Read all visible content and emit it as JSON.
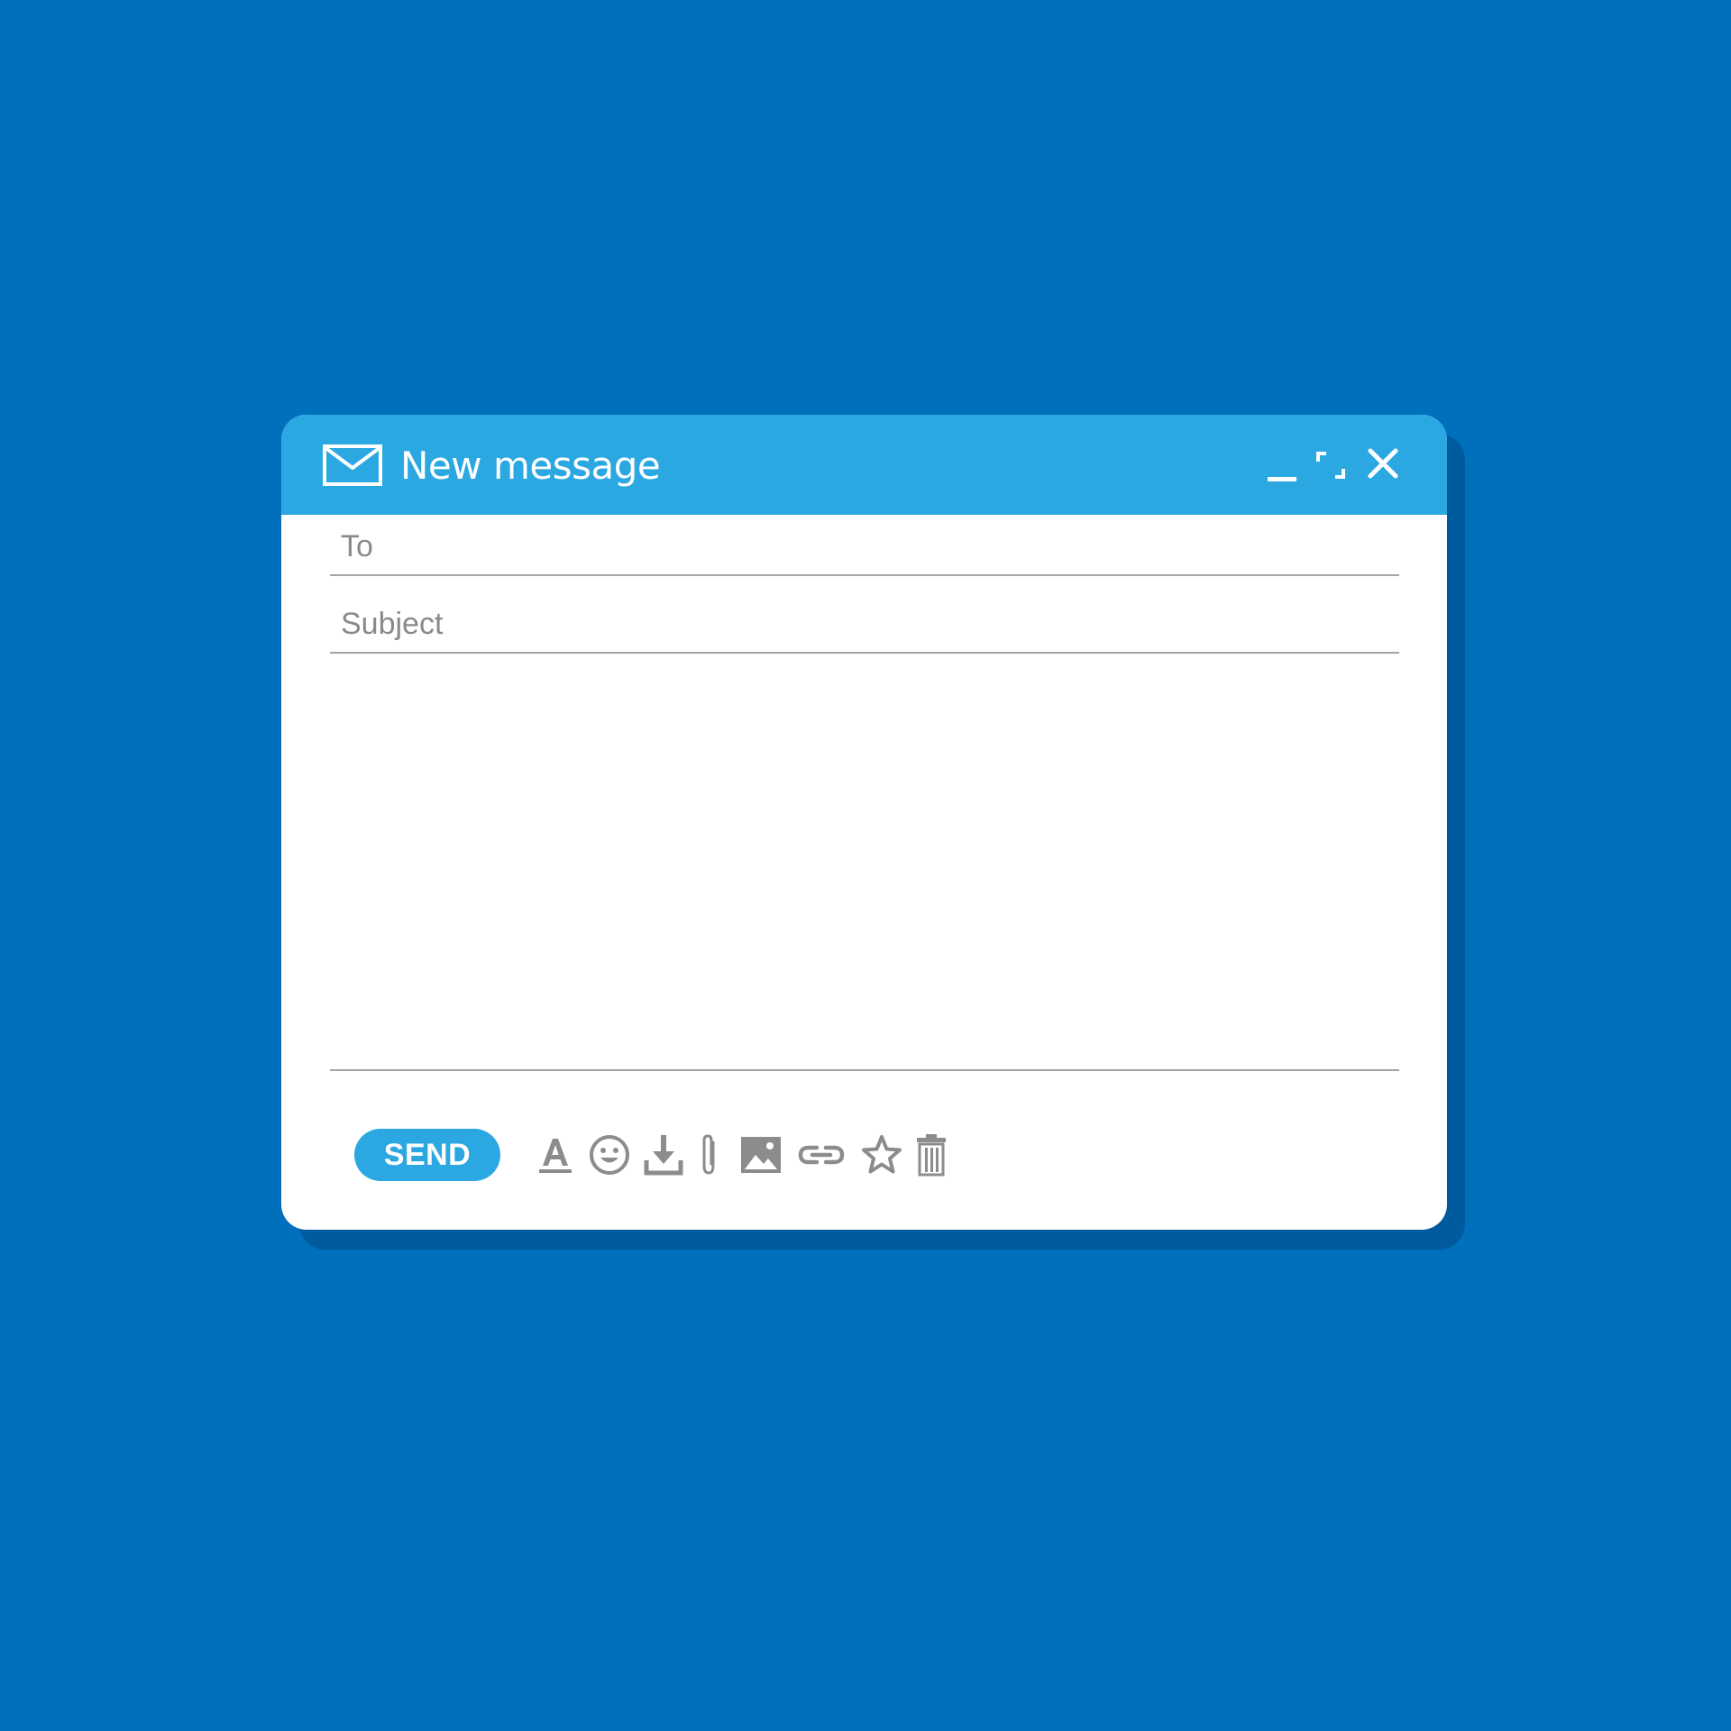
{
  "window": {
    "title": "New message",
    "title_icon": "envelope-icon",
    "controls": [
      {
        "name": "minimize",
        "icon": "minimize-icon"
      },
      {
        "name": "maximize",
        "icon": "maximize-icon"
      },
      {
        "name": "close",
        "icon": "close-icon"
      }
    ]
  },
  "form": {
    "to": {
      "placeholder": "To",
      "value": ""
    },
    "subject": {
      "placeholder": "Subject",
      "value": ""
    },
    "body": {
      "value": ""
    }
  },
  "toolbar": {
    "send_label": "SEND",
    "tools": [
      "text-format-icon",
      "emoji-icon",
      "download-icon",
      "attachment-icon",
      "image-icon",
      "link-icon",
      "star-icon",
      "trash-icon"
    ]
  },
  "colors": {
    "background": "#0070bd",
    "shadow": "#005a9e",
    "titlebar": "#2ba8e2",
    "send_button": "#2ba8e2",
    "window": "#ffffff",
    "icon_gray": "#8c8c8c",
    "divider": "#a3a3a3"
  }
}
